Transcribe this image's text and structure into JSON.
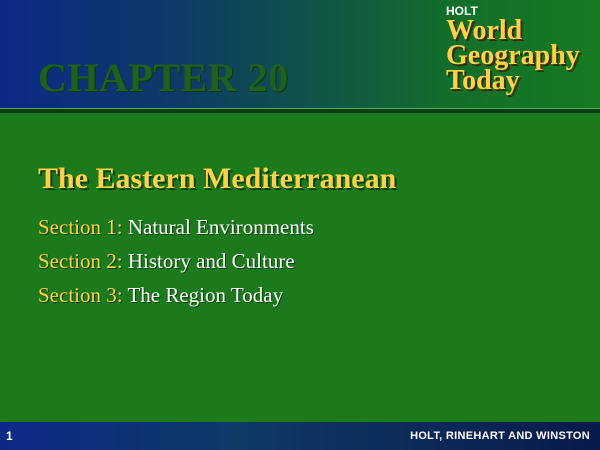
{
  "header": {
    "chapter_title": "CHAPTER 20",
    "brand": {
      "publisher_short": "HOLT",
      "lines": [
        "World",
        "Geography",
        "Today"
      ]
    }
  },
  "main": {
    "title": "The Eastern Mediterranean",
    "sections": [
      {
        "label": "Section 1:",
        "text": "Natural Environments"
      },
      {
        "label": "Section 2:",
        "text": "History and Culture"
      },
      {
        "label": "Section 3:",
        "text": "The Region Today"
      }
    ]
  },
  "footer": {
    "slide_number": "1",
    "publisher": "HOLT, RINEHART AND WINSTON"
  },
  "colors": {
    "background_green": "#1c7a1c",
    "header_blue": "#0b2a86",
    "accent_gold": "#ffd24a",
    "text_white": "#ffffff"
  }
}
